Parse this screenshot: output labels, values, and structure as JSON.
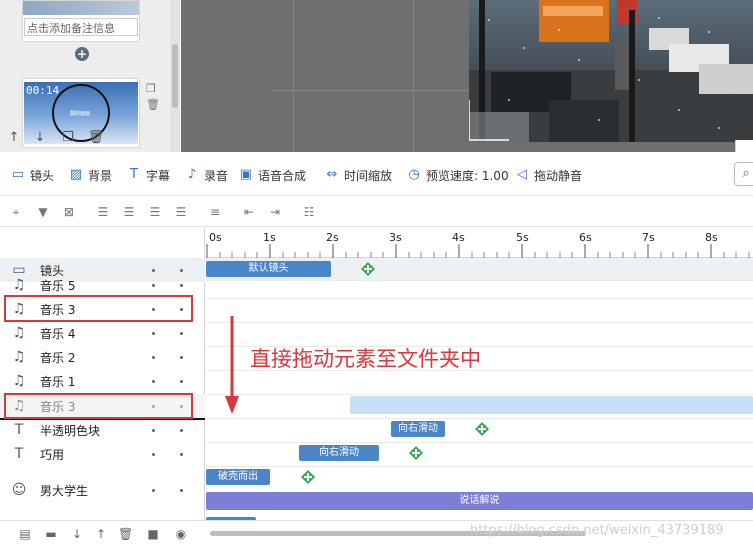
{
  "shot_list": {
    "note_placeholder": "点击添加备注信息",
    "shot_time": "00:14",
    "thumb_caption": "翻转画面"
  },
  "toolbar": {
    "items": [
      {
        "label": "镜头",
        "icon": "camera-icon"
      },
      {
        "label": "背景",
        "icon": "background-icon"
      },
      {
        "label": "字幕",
        "icon": "subtitle-icon"
      },
      {
        "label": "录音",
        "icon": "microphone-icon"
      },
      {
        "label": "语音合成",
        "icon": "speech-synthesis-icon"
      },
      {
        "label": "时间缩放",
        "icon": "time-scale-icon"
      },
      {
        "label": "预览速度: 1.00",
        "icon": "preview-speed-icon"
      },
      {
        "label": "拖动静音",
        "icon": "mute-drag-icon"
      }
    ]
  },
  "ruler": {
    "ticks": [
      "0s",
      "1s",
      "2s",
      "3s",
      "4s",
      "5s",
      "6s",
      "7s",
      "8s"
    ]
  },
  "tracks": [
    {
      "label": "镜头",
      "icon": "camera-icon"
    },
    {
      "label": "音乐 5",
      "icon": "music-icon"
    },
    {
      "label": "音乐 3",
      "icon": "music-icon"
    },
    {
      "label": "音乐 4",
      "icon": "music-icon"
    },
    {
      "label": "音乐 2",
      "icon": "music-icon"
    },
    {
      "label": "音乐 1",
      "icon": "music-icon"
    },
    {
      "label": "音乐 3",
      "icon": "music-icon"
    },
    {
      "label": "半透明色块",
      "icon": "text-icon"
    },
    {
      "label": "巧用",
      "icon": "text-icon"
    },
    {
      "label": "男大学生",
      "icon": "person-icon"
    }
  ],
  "clips": {
    "default_shot": "默认镜头",
    "slide_right_1": "向右滑动",
    "slide_right_2": "向右滑动",
    "burst_out": "破壳而出",
    "talk_explain": "说话解说"
  },
  "annotation": "直接拖动元素至文件夹中",
  "watermark": "https://blog.csdn.net/weixin_43739189",
  "colors": {
    "clip_blue": "#4a86c8",
    "clip_purple": "#7b7fd6",
    "highlight_red": "#d9363e",
    "plus_green": "#3aa856",
    "drag_lane": "#c9dff5"
  }
}
